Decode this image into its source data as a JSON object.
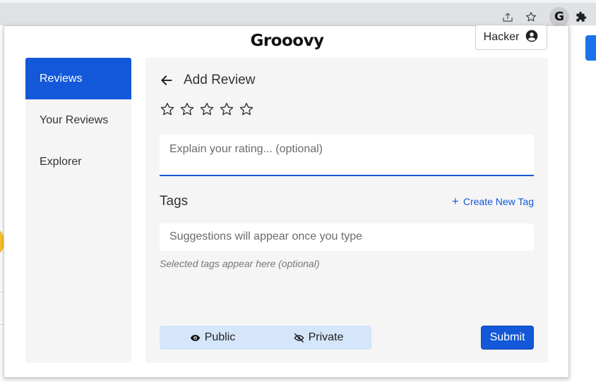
{
  "browser": {
    "toolbar_icons": [
      "share-icon",
      "star-icon",
      "extension-g-icon",
      "puzzle-icon"
    ],
    "extension_letter": "G"
  },
  "app": {
    "brand": "Grooovy",
    "user_name": "Hacker"
  },
  "sidebar": {
    "items": [
      {
        "label": "Reviews",
        "active": true
      },
      {
        "label": "Your Reviews",
        "active": false
      },
      {
        "label": "Explorer",
        "active": false
      }
    ]
  },
  "review_form": {
    "title": "Add Review",
    "star_count": 5,
    "rating": 0,
    "rating_placeholder": "Explain your rating... (optional)",
    "tags_label": "Tags",
    "create_tag_label": "Create New Tag",
    "tag_search_placeholder": "Suggestions will appear once you type",
    "selected_tags_hint": "Selected tags appear here (optional)",
    "visibility_public": "Public",
    "visibility_private": "Private",
    "submit_label": "Submit"
  },
  "colors": {
    "accent": "#1258d8",
    "toggle_bg": "#d5e5fa",
    "panel_bg": "#f5f5f5"
  }
}
